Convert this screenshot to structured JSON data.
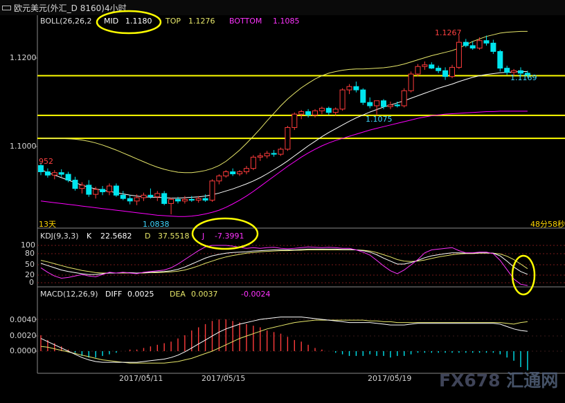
{
  "window": {
    "title": "欧元美元(外汇_D 8160)4小时"
  },
  "boll": {
    "name": "BOLL(26,26,2",
    "mid_label": "MID",
    "mid_value": "1.1180",
    "top_label": "TOP",
    "top_value": "1.1276",
    "bottom_label": "BOTTOM",
    "bottom_value": "1.1085"
  },
  "kdj": {
    "name": "KDJ(9,3,3)",
    "k_label": "K",
    "k_value": "22.5682",
    "d_label": "D",
    "d_value": "37.5518",
    "j_label": "J",
    "j_value": "-7.3991"
  },
  "macd": {
    "name": "MACD(12,26,9)",
    "diff_label": "DIFF",
    "diff_value": "0.0025",
    "dea_label": "DEA",
    "dea_value": "0.0037",
    "macd_value": "-0.0024"
  },
  "price_axis": [
    "1.1200",
    "1.1000"
  ],
  "kdj_axis": [
    "100",
    "80",
    "50",
    "20",
    "0"
  ],
  "macd_axis": [
    "0.0040",
    "0.0020",
    "0.0000"
  ],
  "date_axis": [
    "2017/05/11",
    "2017/05/15",
    "2017/05/19"
  ],
  "annotations": {
    "left_price": "952",
    "low_label": "1.0838",
    "mid_low_label": "1.1075",
    "high_label": "1.1267",
    "last_label": "1.1169",
    "period_label": "13天",
    "timer_label": "48分58秒"
  },
  "watermark": {
    "brand": "FX678",
    "cn": "汇通网"
  },
  "colors": {
    "up": "#ff3b3b",
    "down": "#00e5ee",
    "highlight": "#ffff00",
    "mid_line": "#ffffff",
    "top_line": "#e8e86a",
    "bottom_line": "#ff00ff"
  },
  "chart_data": {
    "type": "candlestick",
    "instrument": "欧元美元",
    "timeframe": "4小时",
    "ylim": [
      1.0825,
      1.1285
    ],
    "horizontal_levels": [
      1.117,
      1.1075,
      1.102
    ],
    "candles": [
      [
        1.0955,
        1.0962,
        1.0932,
        1.094
      ],
      [
        1.094,
        1.0948,
        1.0926,
        1.0932
      ],
      [
        1.0932,
        1.0944,
        1.0922,
        1.0938
      ],
      [
        1.0938,
        1.0946,
        1.0928,
        1.0934
      ],
      [
        1.0934,
        1.094,
        1.0915,
        1.092
      ],
      [
        1.092,
        1.0928,
        1.0895,
        1.09
      ],
      [
        1.09,
        1.0915,
        1.0888,
        1.0908
      ],
      [
        1.0908,
        1.092,
        1.088,
        1.0886
      ],
      [
        1.0886,
        1.0904,
        1.0876,
        1.0898
      ],
      [
        1.0898,
        1.0906,
        1.0884,
        1.0892
      ],
      [
        1.0892,
        1.0912,
        1.0884,
        1.0906
      ],
      [
        1.0906,
        1.0912,
        1.088,
        1.0884
      ],
      [
        1.0884,
        1.0894,
        1.0872,
        1.0876
      ],
      [
        1.0876,
        1.0884,
        1.0862,
        1.087
      ],
      [
        1.087,
        1.0886,
        1.086,
        1.0878
      ],
      [
        1.0878,
        1.089,
        1.087,
        1.0884
      ],
      [
        1.0884,
        1.09,
        1.0876,
        1.088
      ],
      [
        1.088,
        1.0894,
        1.087,
        1.0888
      ],
      [
        1.0888,
        1.0894,
        1.086,
        1.0864
      ],
      [
        1.0864,
        1.0878,
        1.0838,
        1.0874
      ],
      [
        1.0874,
        1.088,
        1.0864,
        1.087
      ],
      [
        1.087,
        1.0882,
        1.0864,
        1.0874
      ],
      [
        1.0874,
        1.0882,
        1.0868,
        1.0872
      ],
      [
        1.0872,
        1.0882,
        1.0866,
        1.0876
      ],
      [
        1.0876,
        1.0886,
        1.0868,
        1.0872
      ],
      [
        1.0872,
        1.0922,
        1.0868,
        1.0918
      ],
      [
        1.0918,
        1.0934,
        1.091,
        1.093
      ],
      [
        1.093,
        1.0944,
        1.0926,
        1.094
      ],
      [
        1.094,
        1.0948,
        1.093,
        1.0935
      ],
      [
        1.0935,
        1.0944,
        1.093,
        1.094
      ],
      [
        1.094,
        1.0954,
        1.0934,
        1.0948
      ],
      [
        1.0948,
        1.098,
        1.0944,
        1.0975
      ],
      [
        1.0975,
        1.0985,
        1.0966,
        1.0978
      ],
      [
        1.0978,
        1.099,
        1.0972,
        1.0984
      ],
      [
        1.0984,
        1.0992,
        1.0976,
        1.0982
      ],
      [
        1.0982,
        1.0998,
        1.0978,
        1.0994
      ],
      [
        1.0994,
        1.105,
        1.099,
        1.1046
      ],
      [
        1.1046,
        1.1082,
        1.104,
        1.1078
      ],
      [
        1.1078,
        1.1088,
        1.1066,
        1.1084
      ],
      [
        1.1084,
        1.109,
        1.107,
        1.1076
      ],
      [
        1.1076,
        1.109,
        1.107,
        1.1086
      ],
      [
        1.1086,
        1.1096,
        1.1078,
        1.1092
      ],
      [
        1.1092,
        1.1096,
        1.1076,
        1.1082
      ],
      [
        1.1082,
        1.1094,
        1.1074,
        1.109
      ],
      [
        1.109,
        1.114,
        1.1086,
        1.1136
      ],
      [
        1.1136,
        1.115,
        1.1126,
        1.1144
      ],
      [
        1.1144,
        1.1156,
        1.113,
        1.1136
      ],
      [
        1.1136,
        1.114,
        1.11,
        1.1106
      ],
      [
        1.1106,
        1.1118,
        1.1092,
        1.1098
      ],
      [
        1.1098,
        1.1104,
        1.1075,
        1.111
      ],
      [
        1.111,
        1.1114,
        1.109,
        1.1096
      ],
      [
        1.1096,
        1.1108,
        1.109,
        1.11
      ],
      [
        1.11,
        1.1108,
        1.1094,
        1.1098
      ],
      [
        1.1098,
        1.114,
        1.1094,
        1.1134
      ],
      [
        1.1134,
        1.118,
        1.113,
        1.1174
      ],
      [
        1.1174,
        1.1198,
        1.1168,
        1.1192
      ],
      [
        1.1192,
        1.1204,
        1.1184,
        1.1196
      ],
      [
        1.1196,
        1.1202,
        1.1186,
        1.1188
      ],
      [
        1.1188,
        1.1194,
        1.1176,
        1.1182
      ],
      [
        1.1182,
        1.119,
        1.116,
        1.1168
      ],
      [
        1.1168,
        1.1196,
        1.1164,
        1.119
      ],
      [
        1.119,
        1.1267,
        1.1186,
        1.125
      ],
      [
        1.125,
        1.1258,
        1.1238,
        1.1242
      ],
      [
        1.1242,
        1.1252,
        1.1232,
        1.1236
      ],
      [
        1.1236,
        1.1262,
        1.1232,
        1.1254
      ],
      [
        1.1254,
        1.1266,
        1.1242,
        1.1248
      ],
      [
        1.1248,
        1.1256,
        1.1222,
        1.1228
      ],
      [
        1.1228,
        1.1232,
        1.118,
        1.1188
      ],
      [
        1.1188,
        1.1194,
        1.1172,
        1.1178
      ],
      [
        1.1178,
        1.1186,
        1.117,
        1.1182
      ],
      [
        1.1182,
        1.119,
        1.1168,
        1.1176
      ],
      [
        1.1176,
        1.1182,
        1.1166,
        1.1172
      ]
    ],
    "boll_mid": [
      1.0945,
      1.0938,
      1.0932,
      1.0926,
      1.092,
      1.0914,
      1.0908,
      1.0903,
      1.0899,
      1.0896,
      1.0893,
      1.089,
      1.0887,
      1.0884,
      1.0882,
      1.088,
      1.0879,
      1.0879,
      1.0878,
      1.0877,
      1.0877,
      1.0878,
      1.0879,
      1.088,
      1.0882,
      1.0885,
      1.0889,
      1.0894,
      1.0899,
      1.0905,
      1.0911,
      1.0918,
      1.0926,
      1.0935,
      1.0945,
      1.0955,
      1.0966,
      1.0978,
      1.099,
      1.1002,
      1.1013,
      1.1024,
      1.1034,
      1.1043,
      1.1052,
      1.1061,
      1.1069,
      1.1076,
      1.1083,
      1.1089,
      1.1095,
      1.11,
      1.1105,
      1.111,
      1.1116,
      1.1122,
      1.1128,
      1.1134,
      1.114,
      1.1145,
      1.115,
      1.1156,
      1.1161,
      1.1166,
      1.117,
      1.1173,
      1.1175,
      1.1177,
      1.1178,
      1.1179,
      1.118,
      1.118
    ],
    "boll_top": [
      1.102,
      1.102,
      1.102,
      1.102,
      1.1019,
      1.1018,
      1.1016,
      1.1013,
      1.1009,
      1.1004,
      1.0998,
      1.0992,
      1.0985,
      1.0978,
      1.0971,
      1.0964,
      1.0957,
      1.0951,
      1.0946,
      1.0942,
      1.0939,
      1.0938,
      1.0938,
      1.094,
      1.0943,
      1.0948,
      1.0955,
      1.0965,
      1.0978,
      1.0992,
      1.1008,
      1.1025,
      1.1043,
      1.1062,
      1.108,
      1.1098,
      1.1114,
      1.1128,
      1.1141,
      1.1152,
      1.1162,
      1.117,
      1.1176,
      1.118,
      1.1183,
      1.1185,
      1.1186,
      1.1186,
      1.1187,
      1.1188,
      1.1189,
      1.1191,
      1.1194,
      1.1198,
      1.1203,
      1.1208,
      1.1213,
      1.1218,
      1.1222,
      1.1226,
      1.123,
      1.1236,
      1.1244,
      1.1252,
      1.1258,
      1.1264,
      1.1268,
      1.1272,
      1.1274,
      1.1275,
      1.1276,
      1.1276
    ],
    "boll_bottom": [
      1.087,
      1.0868,
      1.0866,
      1.0864,
      1.0862,
      1.086,
      1.0858,
      1.0856,
      1.0854,
      1.0852,
      1.085,
      1.0848,
      1.0846,
      1.0844,
      1.0842,
      1.084,
      1.0838,
      1.0836,
      1.0835,
      1.0834,
      1.0833,
      1.0833,
      1.0834,
      1.0836,
      1.0839,
      1.0843,
      1.0848,
      1.0855,
      1.0863,
      1.0872,
      1.0882,
      1.0893,
      1.0905,
      1.0917,
      1.0929,
      1.0941,
      1.0953,
      1.0964,
      1.0975,
      1.0985,
      1.0994,
      1.1002,
      1.1009,
      1.1015,
      1.102,
      1.1025,
      1.103,
      1.1035,
      1.104,
      1.1044,
      1.1048,
      1.1052,
      1.1056,
      1.106,
      1.1064,
      1.1068,
      1.1071,
      1.1074,
      1.1076,
      1.1078,
      1.1079,
      1.108,
      1.1081,
      1.1082,
      1.1083,
      1.1084,
      1.1084,
      1.1085,
      1.1085,
      1.1085,
      1.1085,
      1.1085
    ],
    "kdj_k": [
      52,
      46,
      40,
      34,
      30,
      27,
      24,
      22,
      22,
      24,
      26,
      26,
      27,
      27,
      26,
      27,
      28,
      29,
      30,
      32,
      36,
      42,
      50,
      58,
      66,
      72,
      76,
      79,
      81,
      82,
      83,
      85,
      86,
      87,
      88,
      88,
      88,
      88,
      89,
      90,
      90,
      90,
      90,
      90,
      89,
      89,
      88,
      86,
      82,
      75,
      66,
      58,
      50,
      50,
      54,
      60,
      67,
      72,
      75,
      78,
      80,
      80,
      79,
      79,
      80,
      80,
      79,
      72,
      58,
      42,
      30,
      22.6
    ],
    "kdj_d": [
      60,
      56,
      51,
      46,
      41,
      37,
      33,
      30,
      27,
      26,
      26,
      26,
      26,
      26,
      26,
      26,
      27,
      27,
      28,
      29,
      31,
      34,
      39,
      45,
      52,
      58,
      64,
      69,
      73,
      76,
      79,
      81,
      83,
      84,
      85,
      86,
      86,
      87,
      87,
      88,
      88,
      88,
      88,
      88,
      88,
      88,
      88,
      87,
      85,
      81,
      75,
      69,
      62,
      58,
      57,
      58,
      61,
      65,
      69,
      72,
      75,
      77,
      78,
      78,
      79,
      79,
      79,
      77,
      71,
      62,
      50,
      37.6
    ],
    "kdj_j": [
      40,
      28,
      18,
      12,
      14,
      18,
      22,
      18,
      16,
      22,
      28,
      26,
      28,
      26,
      24,
      28,
      30,
      32,
      34,
      40,
      50,
      62,
      74,
      86,
      96,
      100,
      100,
      100,
      98,
      95,
      92,
      94,
      92,
      94,
      95,
      92,
      91,
      92,
      94,
      96,
      95,
      94,
      95,
      94,
      92,
      92,
      88,
      82,
      74,
      60,
      45,
      32,
      24,
      34,
      48,
      62,
      80,
      88,
      90,
      92,
      94,
      86,
      80,
      80,
      82,
      82,
      78,
      60,
      35,
      10,
      -4,
      -7.4
    ],
    "macd_diff": [
      0.0016,
      0.0012,
      0.0008,
      0.0004,
      0.0,
      -0.0004,
      -0.0008,
      -0.0011,
      -0.0013,
      -0.0014,
      -0.0014,
      -0.0014,
      -0.0014,
      -0.0014,
      -0.0014,
      -0.0013,
      -0.0012,
      -0.0011,
      -0.001,
      -0.0008,
      -0.0005,
      -0.0001,
      0.0004,
      0.0009,
      0.0014,
      0.0019,
      0.0024,
      0.0028,
      0.0031,
      0.0034,
      0.0036,
      0.0038,
      0.004,
      0.0041,
      0.0042,
      0.0043,
      0.0043,
      0.0043,
      0.0043,
      0.0042,
      0.0041,
      0.004,
      0.0039,
      0.0038,
      0.0037,
      0.0036,
      0.0036,
      0.0036,
      0.0036,
      0.0035,
      0.0034,
      0.0033,
      0.0033,
      0.0033,
      0.0034,
      0.0035,
      0.0035,
      0.0035,
      0.0035,
      0.0035,
      0.0035,
      0.0035,
      0.0035,
      0.0035,
      0.0035,
      0.0035,
      0.0035,
      0.0034,
      0.0031,
      0.0028,
      0.0026,
      0.0025
    ],
    "macd_dea": [
      0.0006,
      0.0005,
      0.0003,
      0.0001,
      -0.0001,
      -0.0003,
      -0.0005,
      -0.0007,
      -0.0009,
      -0.0011,
      -0.0012,
      -0.0013,
      -0.0014,
      -0.0015,
      -0.0015,
      -0.0015,
      -0.0015,
      -0.0015,
      -0.0015,
      -0.0014,
      -0.0013,
      -0.0011,
      -0.0009,
      -0.0006,
      -0.0003,
      0.0,
      0.0004,
      0.0008,
      0.0012,
      0.0016,
      0.0019,
      0.0022,
      0.0025,
      0.0028,
      0.003,
      0.0032,
      0.0034,
      0.0036,
      0.0037,
      0.0038,
      0.0039,
      0.0039,
      0.0039,
      0.0039,
      0.0039,
      0.0039,
      0.0039,
      0.0039,
      0.0038,
      0.0038,
      0.0037,
      0.0037,
      0.0036,
      0.0036,
      0.0036,
      0.0036,
      0.0036,
      0.0036,
      0.0036,
      0.0036,
      0.0036,
      0.0036,
      0.0036,
      0.0036,
      0.0036,
      0.0036,
      0.0036,
      0.0036,
      0.0035,
      0.0034,
      0.0036,
      0.0037
    ]
  }
}
